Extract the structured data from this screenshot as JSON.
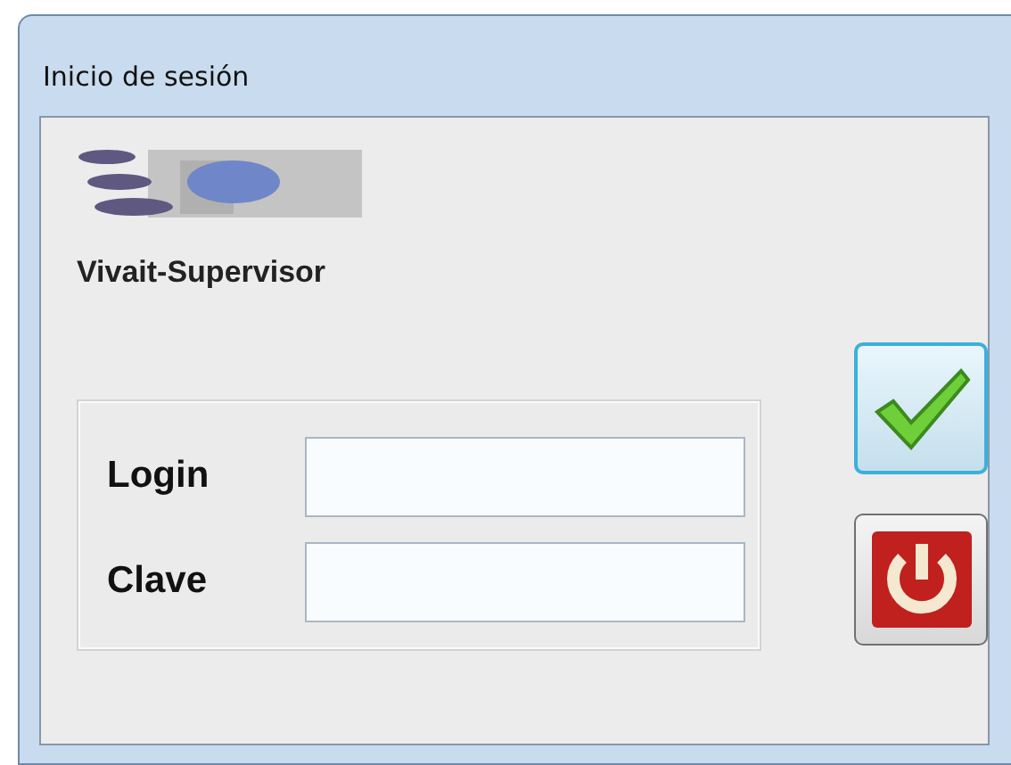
{
  "window": {
    "title": "Inicio de sesión"
  },
  "app_name": "Vivait-Supervisor",
  "fields": [
    {
      "label": "Login"
    },
    {
      "label": "Clave"
    }
  ],
  "buttons": [
    {
      "kind": "confirm",
      "highlighted": true
    },
    {
      "kind": "power",
      "highlighted": false
    }
  ]
}
